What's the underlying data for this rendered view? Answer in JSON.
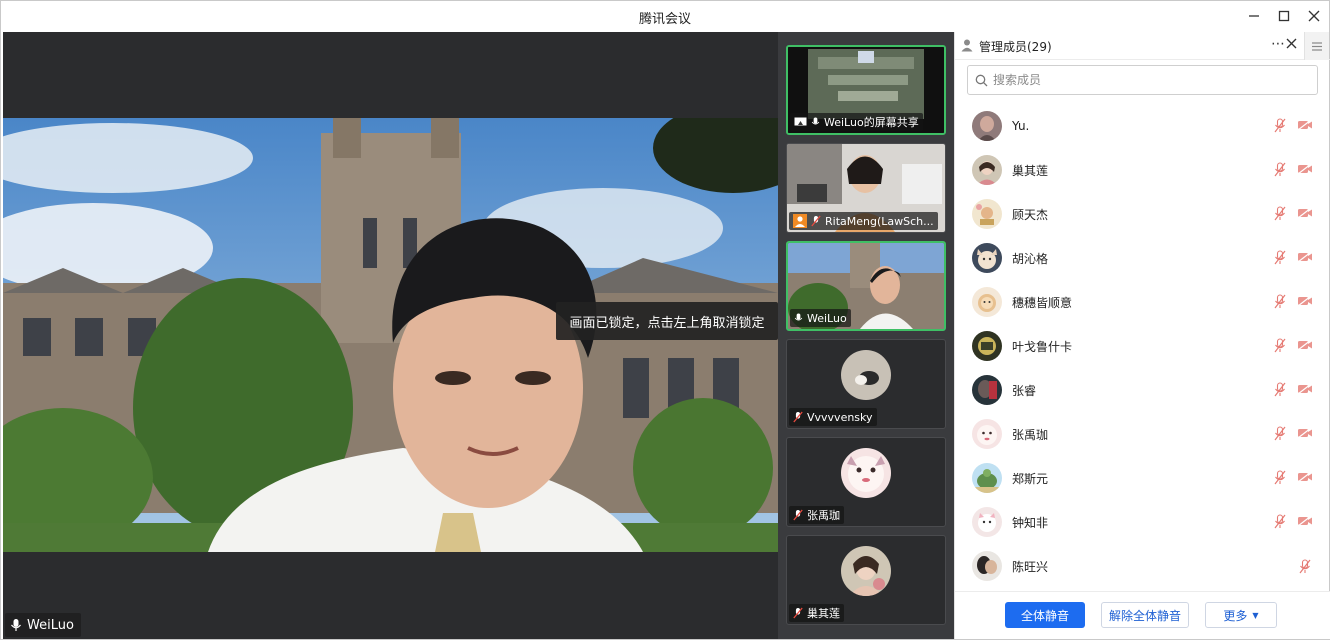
{
  "app": {
    "title": "腾讯会议"
  },
  "main_video": {
    "speaker_name": "WeiLuo",
    "lock_tip": "画面已锁定，点击左上角取消锁定"
  },
  "thumbnails": [
    {
      "label": "WeiLuo的屏幕共享",
      "type": "screen-share",
      "active": true
    },
    {
      "label": "RitaMeng(LawSch...",
      "type": "video",
      "active": false
    },
    {
      "label": "WeiLuo",
      "type": "video",
      "active": true
    },
    {
      "label": "Vvvvvensky",
      "type": "avatar",
      "active": false
    },
    {
      "label": "张禹珈",
      "type": "avatar",
      "active": false
    },
    {
      "label": "巢其莲",
      "type": "avatar",
      "active": false
    }
  ],
  "panel": {
    "title": "管理成员(29)",
    "search_placeholder": "搜索成员",
    "members": [
      {
        "name": "Yu.",
        "mic": "muted",
        "camera": "off"
      },
      {
        "name": "巢其莲",
        "mic": "muted",
        "camera": "off"
      },
      {
        "name": "顾天杰",
        "mic": "muted",
        "camera": "off"
      },
      {
        "name": "胡沁格",
        "mic": "muted",
        "camera": "off"
      },
      {
        "name": "穗穗皆顺意",
        "mic": "muted",
        "camera": "off"
      },
      {
        "name": "叶戈鲁什卡",
        "mic": "muted",
        "camera": "off"
      },
      {
        "name": "张睿",
        "mic": "muted",
        "camera": "off"
      },
      {
        "name": "张禹珈",
        "mic": "muted",
        "camera": "off"
      },
      {
        "name": "郑斯元",
        "mic": "muted",
        "camera": "off"
      },
      {
        "name": "钟知非",
        "mic": "muted",
        "camera": "off"
      },
      {
        "name": "陈旺兴",
        "mic": "muted",
        "camera": ""
      }
    ],
    "buttons": {
      "mute_all": "全体静音",
      "unmute_all": "解除全体静音",
      "more": "更多"
    }
  }
}
